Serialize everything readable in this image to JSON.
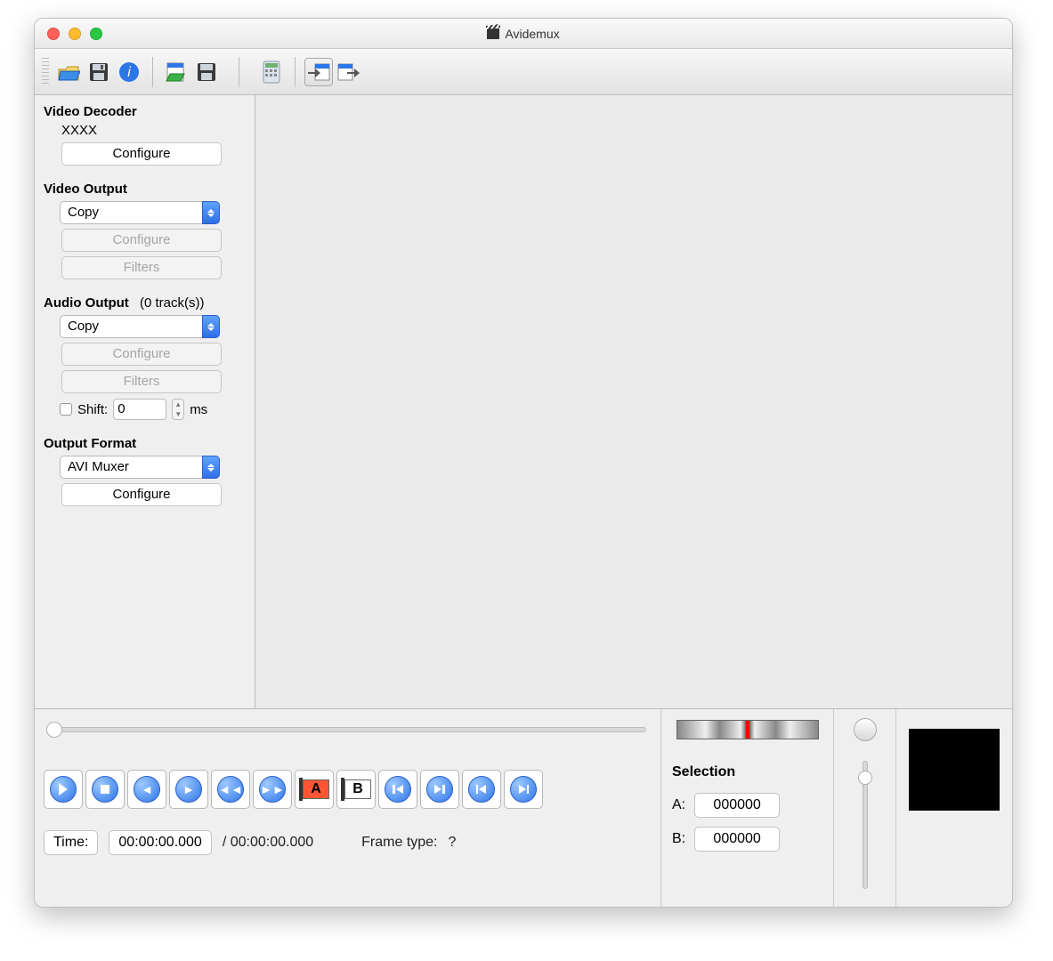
{
  "window": {
    "title": "Avidemux"
  },
  "sidebar": {
    "video_decoder": {
      "title": "Video Decoder",
      "codec": "XXXX",
      "configure": "Configure"
    },
    "video_output": {
      "title": "Video Output",
      "selected": "Copy",
      "configure": "Configure",
      "filters": "Filters"
    },
    "audio_output": {
      "title": "Audio Output",
      "tracks": "(0 track(s))",
      "selected": "Copy",
      "configure": "Configure",
      "filters": "Filters",
      "shift_label": "Shift:",
      "shift_value": "0",
      "shift_unit": "ms"
    },
    "output_format": {
      "title": "Output Format",
      "selected": "AVI Muxer",
      "configure": "Configure"
    }
  },
  "transport": {
    "time_label": "Time:",
    "time_value": "00:00:00.000",
    "time_total": "/ 00:00:00.000",
    "frame_type_label": "Frame type:",
    "frame_type_value": "?",
    "marker_a_label": "A",
    "marker_b_label": "B"
  },
  "selection": {
    "title": "Selection",
    "a_label": "A:",
    "b_label": "B:",
    "a_value": "000000",
    "b_value": "000000"
  }
}
